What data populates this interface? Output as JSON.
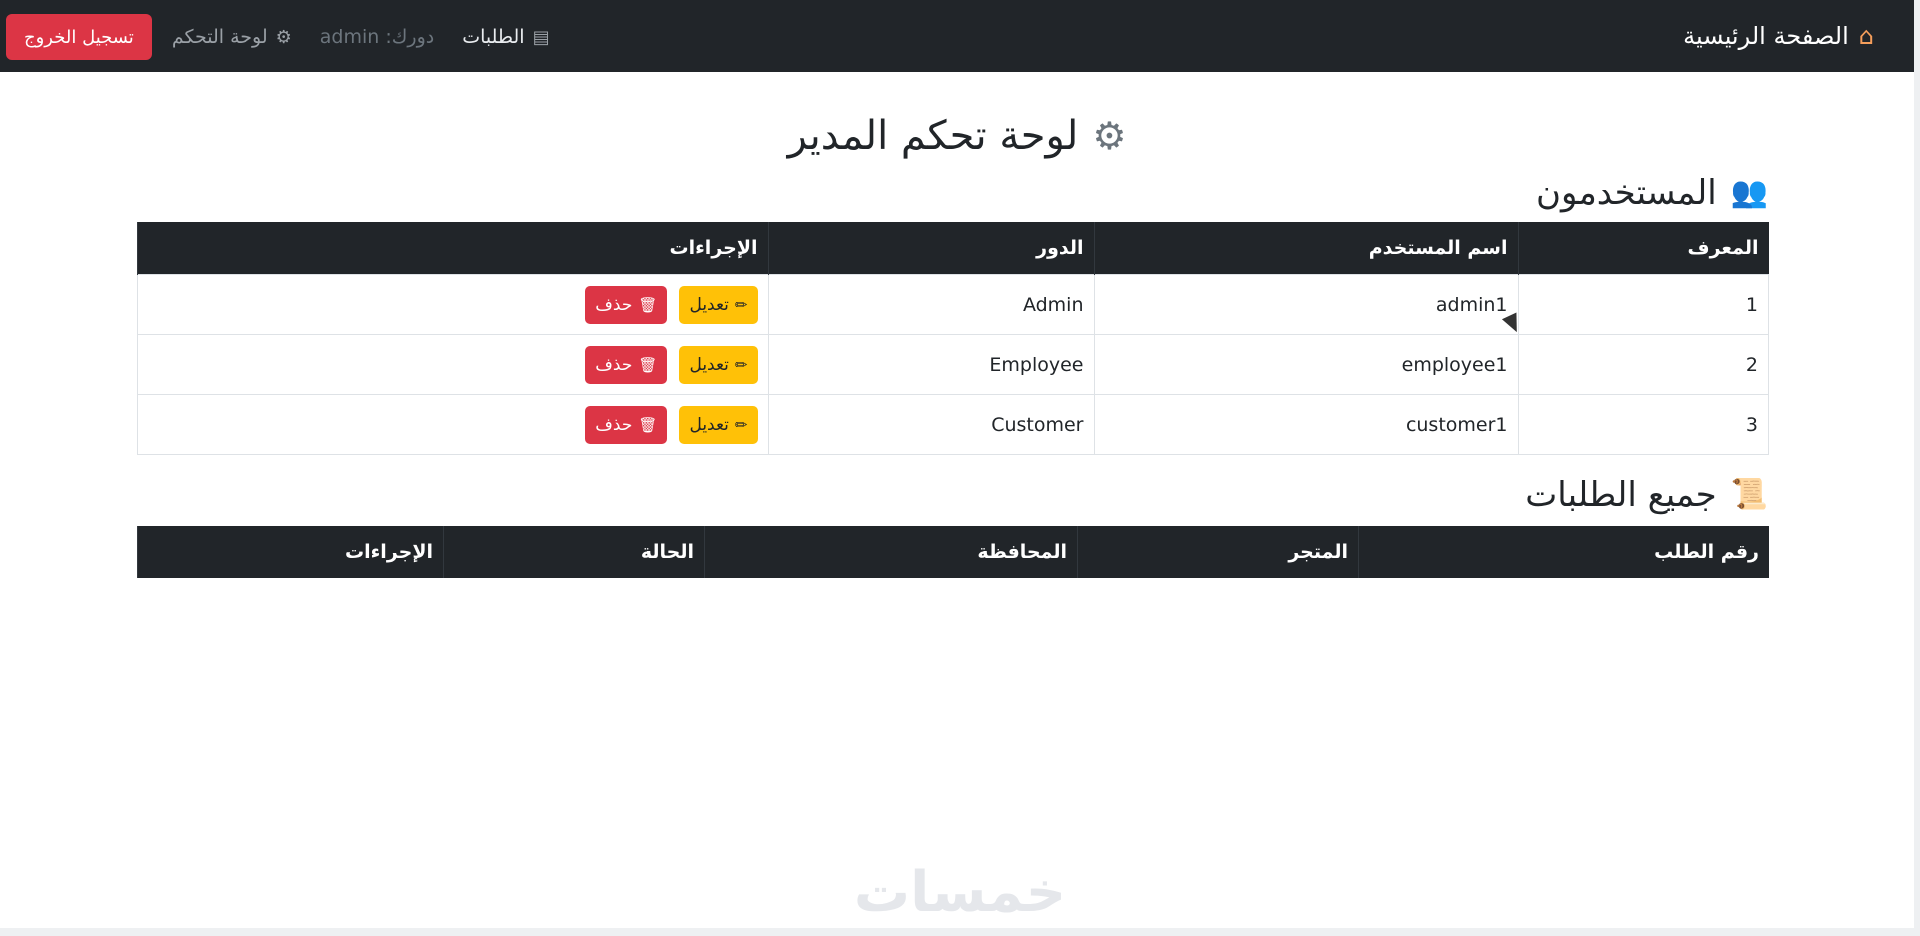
{
  "navbar": {
    "brand": "الصفحة الرئيسية",
    "brand_icon": "house-icon",
    "orders_link": "الطلبات",
    "orders_icon": "document-icon",
    "role_text": "دورك: admin",
    "dashboard_link": "لوحة التحكم",
    "dashboard_icon": "gear-icon",
    "logout_label": "تسجيل الخروج"
  },
  "page": {
    "title": "لوحة تحكم المدير",
    "title_icon": "gear-icon"
  },
  "users": {
    "title": "المستخدمون",
    "title_icon": "users-icon",
    "headers": [
      "المعرف",
      "اسم المستخدم",
      "الدور",
      "الإجراءات"
    ],
    "rows": [
      {
        "id": "1",
        "username": "admin1",
        "role": "Admin"
      },
      {
        "id": "2",
        "username": "employee1",
        "role": "Employee"
      },
      {
        "id": "3",
        "username": "customer1",
        "role": "Customer"
      }
    ],
    "edit_label": "تعديل",
    "delete_label": "حذف"
  },
  "orders": {
    "title": "جميع الطلبات",
    "title_icon": "scroll-icon",
    "headers": [
      "رقم الطلب",
      "المتجر",
      "المحافظة",
      "الحالة",
      "الإجراءات"
    ]
  },
  "watermark": "خمسات",
  "colors": {
    "navbar_bg": "#212529",
    "danger": "#dc3545",
    "warning": "#ffc107"
  }
}
